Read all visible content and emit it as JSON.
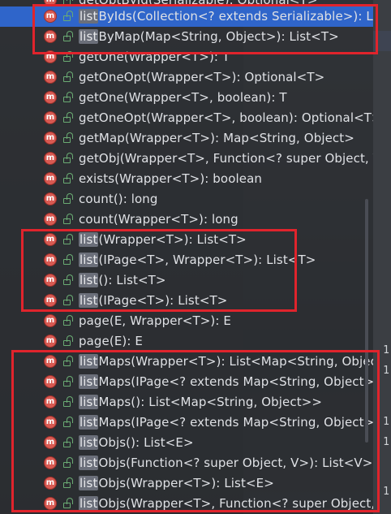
{
  "top_partial_text": "getOptById(Serializable): Optional<T>",
  "match_text": "list",
  "items": [
    {
      "prefix": "list",
      "rest": "ByIds(Collection<? extends Serializable>): List<"
    },
    {
      "prefix": "list",
      "rest": "ByMap(Map<String, Object>): List<T>"
    },
    {
      "prefix": "",
      "rest": "getOne(Wrapper<T>): T"
    },
    {
      "prefix": "",
      "rest": "getOneOpt(Wrapper<T>): Optional<T>"
    },
    {
      "prefix": "",
      "rest": "getOne(Wrapper<T>, boolean): T"
    },
    {
      "prefix": "",
      "rest": "getOneOpt(Wrapper<T>, boolean): Optional<T>"
    },
    {
      "prefix": "",
      "rest": "getMap(Wrapper<T>): Map<String, Object>"
    },
    {
      "prefix": "",
      "rest": "getObj(Wrapper<T>, Function<? super Object, V"
    },
    {
      "prefix": "",
      "rest": "exists(Wrapper<T>): boolean"
    },
    {
      "prefix": "",
      "rest": "count(): long"
    },
    {
      "prefix": "",
      "rest": "count(Wrapper<T>): long"
    },
    {
      "prefix": "list",
      "rest": "(Wrapper<T>): List<T>"
    },
    {
      "prefix": "list",
      "rest": "(IPage<T>, Wrapper<T>): List<T>"
    },
    {
      "prefix": "list",
      "rest": "(): List<T>"
    },
    {
      "prefix": "list",
      "rest": "(IPage<T>): List<T>"
    },
    {
      "prefix": "",
      "rest": "page(E, Wrapper<T>): E"
    },
    {
      "prefix": "",
      "rest": "page(E): E"
    },
    {
      "prefix": "list",
      "rest": "Maps(Wrapper<T>): List<Map<String, Object"
    },
    {
      "prefix": "list",
      "rest": "Maps(IPage<? extends Map<String, Object>>"
    },
    {
      "prefix": "list",
      "rest": "Maps(): List<Map<String, Object>>"
    },
    {
      "prefix": "list",
      "rest": "Maps(IPage<? extends Map<String, Object>>"
    },
    {
      "prefix": "list",
      "rest": "Objs(): List<E>"
    },
    {
      "prefix": "list",
      "rest": "Objs(Function<? super Object, V>): List<V>"
    },
    {
      "prefix": "list",
      "rest": "Objs(Wrapper<T>): List<E>"
    },
    {
      "prefix": "list",
      "rest": "Objs(Wrapper<T>, Function<? super Object, V"
    }
  ],
  "method_badge": "m",
  "gutter_numbers": [
    "1",
    "1",
    "1",
    "1",
    "1"
  ],
  "colors": {
    "selection": "#2f65ca",
    "highlight_box": "#e0242c",
    "method_icon": "#d85a52",
    "public_lock": "#6aab73"
  }
}
